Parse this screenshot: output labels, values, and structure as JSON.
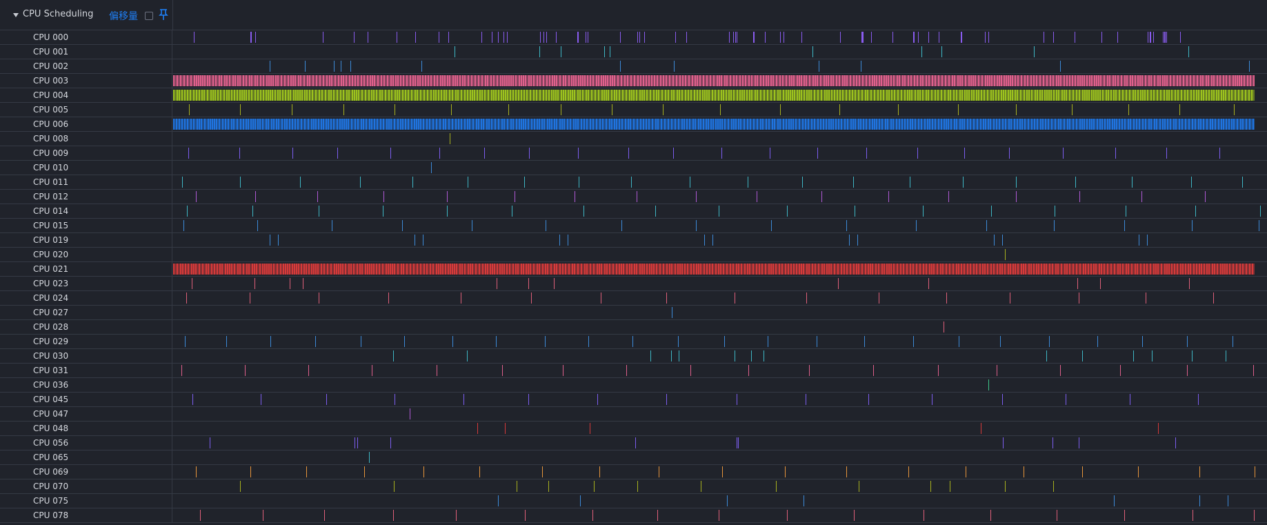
{
  "header": {
    "group_title": "CPU Scheduling",
    "offset_label": "偏移量",
    "checkbox_checked": false,
    "pin_icon": "pin-icon",
    "caret_icon": "caret-down-icon"
  },
  "rows": [
    {
      "label": "CPU 000",
      "color": "#8a5cf0",
      "density": "sparse-bursts"
    },
    {
      "label": "CPU 001",
      "color": "#3fb8c6",
      "density": "sparse"
    },
    {
      "label": "CPU 002",
      "color": "#3d8bd9",
      "density": "sparse"
    },
    {
      "label": "CPU 003",
      "color": "#e0608c",
      "density": "dense"
    },
    {
      "label": "CPU 004",
      "color": "#9cc21e",
      "density": "dense"
    },
    {
      "label": "CPU 005",
      "color": "#a8b11e",
      "density": "periodic"
    },
    {
      "label": "CPU 006",
      "color": "#1f74e0",
      "density": "dense"
    },
    {
      "label": "CPU 008",
      "color": "#a8b11e",
      "density": "single"
    },
    {
      "label": "CPU 009",
      "color": "#7d5ef0",
      "density": "periodic"
    },
    {
      "label": "CPU 010",
      "color": "#3d8bd9",
      "density": "single"
    },
    {
      "label": "CPU 011",
      "color": "#3fb8c6",
      "density": "periodic"
    },
    {
      "label": "CPU 012",
      "color": "#b05ad6",
      "density": "periodic"
    },
    {
      "label": "CPU 014",
      "color": "#3fb8c6",
      "density": "periodic"
    },
    {
      "label": "CPU 015",
      "color": "#3d8bd9",
      "density": "periodic"
    },
    {
      "label": "CPU 019",
      "color": "#3d8bd9",
      "density": "pairs"
    },
    {
      "label": "CPU 020",
      "color": "#a8b11e",
      "density": "single"
    },
    {
      "label": "CPU 021",
      "color": "#d63a3a",
      "density": "dense"
    },
    {
      "label": "CPU 023",
      "color": "#e0607a",
      "density": "sparse"
    },
    {
      "label": "CPU 024",
      "color": "#e0607a",
      "density": "periodic"
    },
    {
      "label": "CPU 027",
      "color": "#3d8bd9",
      "density": "single"
    },
    {
      "label": "CPU 028",
      "color": "#e0607a",
      "density": "single"
    },
    {
      "label": "CPU 029",
      "color": "#3d8bd9",
      "density": "periodic"
    },
    {
      "label": "CPU 030",
      "color": "#3fb8c6",
      "density": "sparse"
    },
    {
      "label": "CPU 031",
      "color": "#e0608c",
      "density": "periodic"
    },
    {
      "label": "CPU 036",
      "color": "#3fc68a",
      "density": "single"
    },
    {
      "label": "CPU 045",
      "color": "#7d5ef0",
      "density": "periodic"
    },
    {
      "label": "CPU 047",
      "color": "#b05ad6",
      "density": "single"
    },
    {
      "label": "CPU 048",
      "color": "#d63a3a",
      "density": "sparse"
    },
    {
      "label": "CPU 056",
      "color": "#7d5ef0",
      "density": "sparse"
    },
    {
      "label": "CPU 065",
      "color": "#3fb8c6",
      "density": "single"
    },
    {
      "label": "CPU 069",
      "color": "#e8963c",
      "density": "periodic"
    },
    {
      "label": "CPU 070",
      "color": "#a8b11e",
      "density": "sparse"
    },
    {
      "label": "CPU 075",
      "color": "#3d8bd9",
      "density": "sparse"
    },
    {
      "label": "CPU 078",
      "color": "#e0607a",
      "density": "periodic"
    }
  ]
}
